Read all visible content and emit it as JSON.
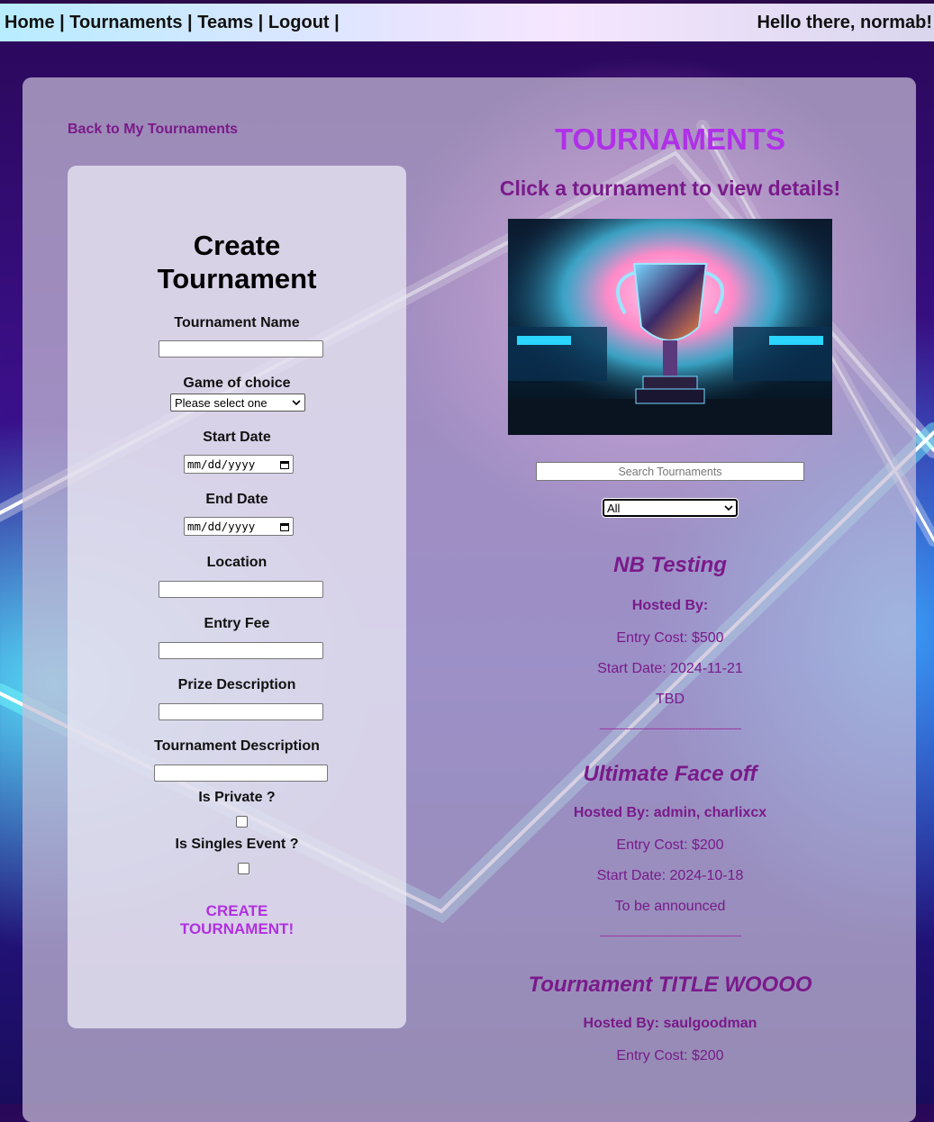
{
  "nav": {
    "items": [
      "Home",
      "Tournaments",
      "Teams",
      "Logout"
    ],
    "separator": " | ",
    "greeting": "Hello there, normab!"
  },
  "back_link": "Back to My Tournaments",
  "form": {
    "title": "Create Tournament",
    "fields": {
      "name_label": "Tournament Name",
      "game_label": "Game of choice",
      "game_selected": "Please select one",
      "start_label": "Start Date",
      "start_placeholder": "mm/dd/yyyy",
      "end_label": "End Date",
      "end_placeholder": "mm/dd/yyyy",
      "location_label": "Location",
      "fee_label": "Entry Fee",
      "prize_label": "Prize Description",
      "desc_label": "Tournament Description",
      "private_label": "Is Private ?",
      "singles_label": "Is Singles Event ?"
    },
    "submit_label": "CREATE TOURNAMENT!"
  },
  "list": {
    "heading": "TOURNAMENTS",
    "subheading": "Click a tournament to view details!",
    "search_placeholder": "Search Tournaments",
    "filter_selected": "All",
    "separator": "-------------------------------------------",
    "tournaments": [
      {
        "name": "NB Testing",
        "hosted_by": "Hosted By:",
        "entry": "Entry Cost: $500",
        "start": "Start Date: 2024-11-21",
        "location": "TBD"
      },
      {
        "name": "Ultimate Face off",
        "hosted_by": "Hosted By: admin, charlixcx",
        "entry": "Entry Cost: $200",
        "start": "Start Date: 2024-10-18",
        "location": "To be announced"
      },
      {
        "name": "Tournament TITLE WOOOO",
        "hosted_by": "Hosted By: saulgoodman",
        "entry": "Entry Cost: $200"
      }
    ]
  },
  "colors": {
    "accent_purple": "#b030e8",
    "heading_plum": "#7a1a8a"
  },
  "icons": [
    "calendar-icon",
    "chevron-down-icon",
    "trophy-image"
  ]
}
